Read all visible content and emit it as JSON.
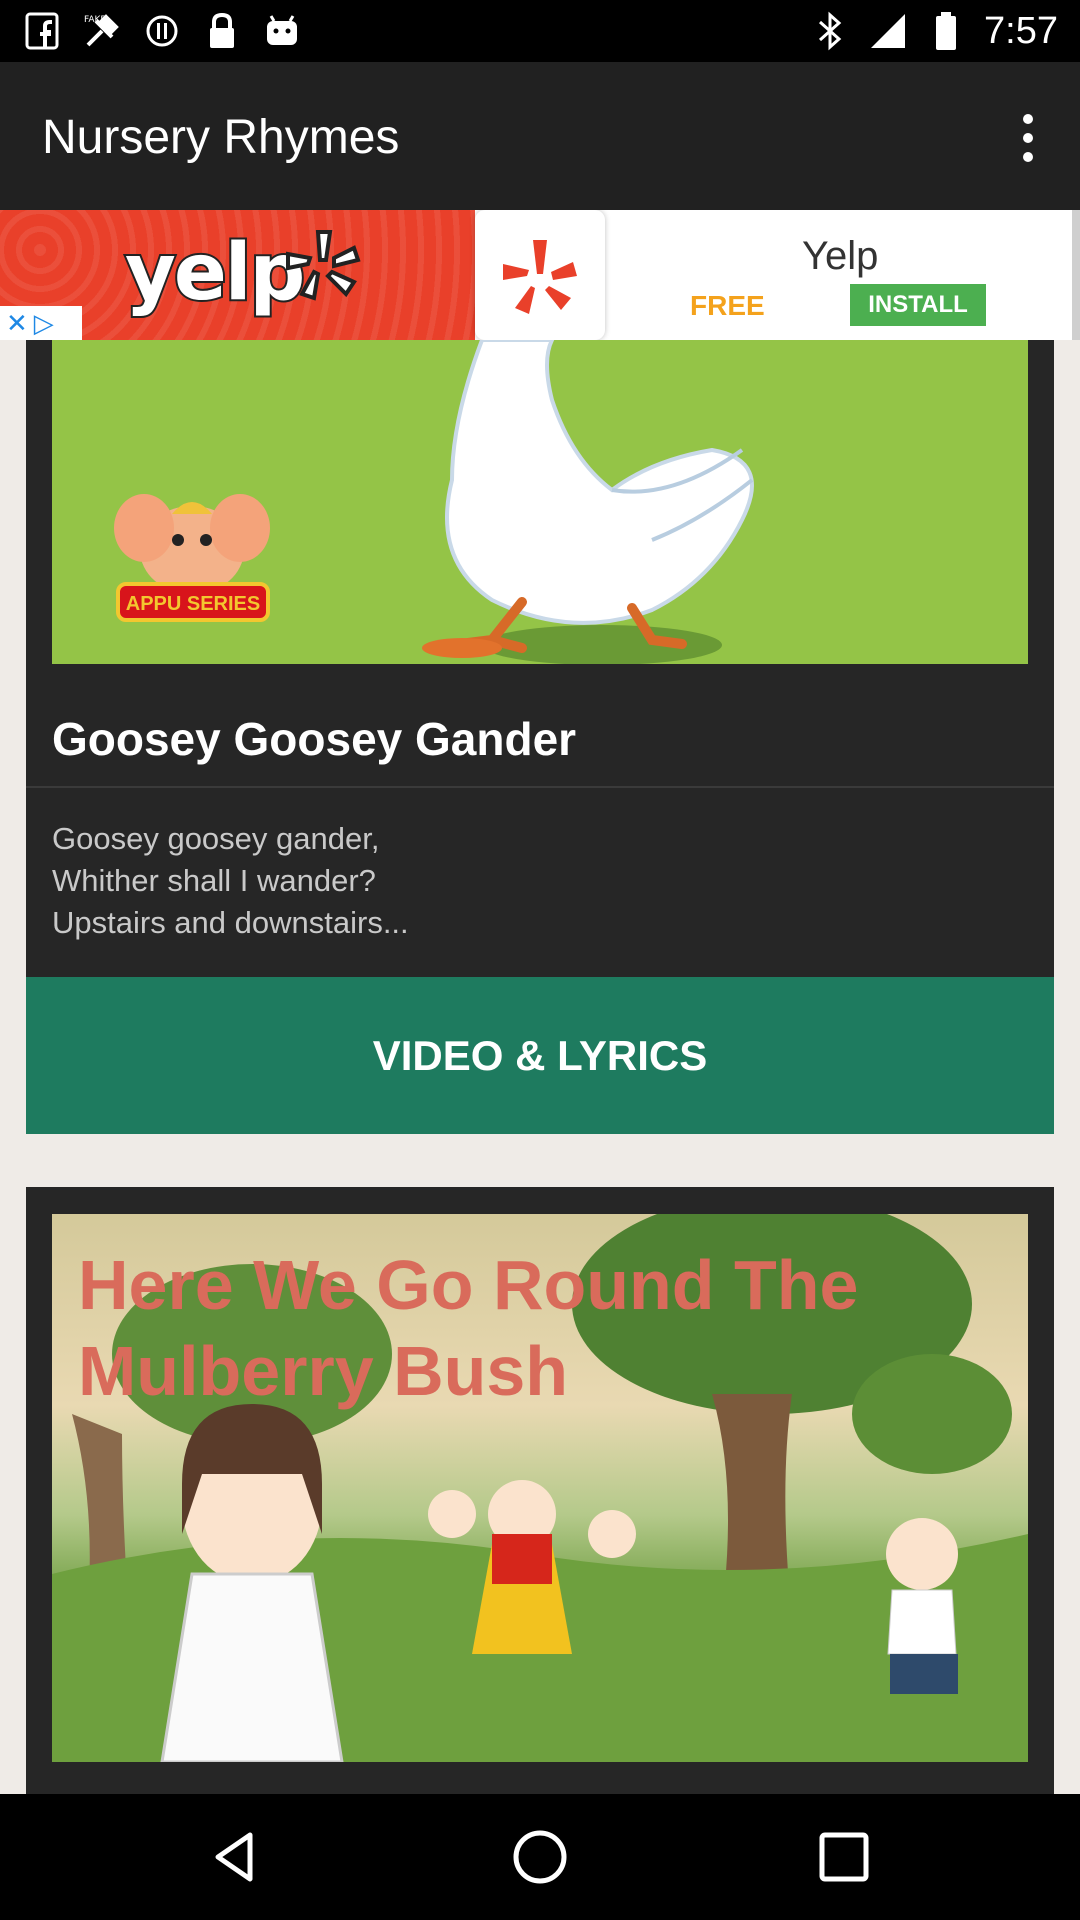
{
  "status_bar": {
    "time": "7:57",
    "left_icons": [
      "facebook-icon",
      "fake-gps-icon",
      "sync-icon",
      "lock-icon",
      "android-icon"
    ],
    "right_icons": [
      "bluetooth-icon",
      "signal-icon",
      "battery-icon"
    ]
  },
  "app_bar": {
    "title": "Nursery Rhymes",
    "menu_icon": "more-vert-icon"
  },
  "ad": {
    "brand_text": "yelp",
    "app_name": "Yelp",
    "price_label": "FREE",
    "install_label": "INSTALL",
    "close_icons": [
      "close-icon",
      "adchoices-icon"
    ],
    "brand_color": "#e9402a",
    "install_color": "#4caf50"
  },
  "cards": [
    {
      "image_caption": "APPU SERIES",
      "title": "Goosey Goosey Gander",
      "excerpt": [
        "Goosey goosey gander,",
        "Whither shall I wander?",
        "Upstairs and downstairs..."
      ],
      "action_label": "VIDEO & LYRICS",
      "action_color": "#1e7b5f"
    },
    {
      "image_title": "Here We Go Round The Mulberry Bush"
    }
  ],
  "nav_bar": {
    "icons": [
      "back-icon",
      "home-icon",
      "recents-icon"
    ]
  }
}
